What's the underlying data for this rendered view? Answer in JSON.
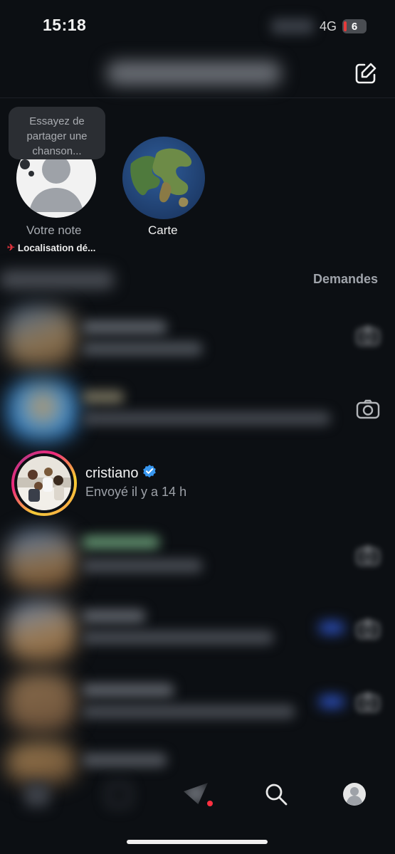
{
  "status_bar": {
    "time": "15:18",
    "network": "4G",
    "battery": "6"
  },
  "notes": {
    "bubble_text": "Essayez de partager une chanson...",
    "your_note_label": "Votre note",
    "location_label": "Localisation dé...",
    "map_label": "Carte"
  },
  "messages_section": {
    "requests_label": "Demandes"
  },
  "conversation": {
    "username": "cristiano",
    "subtitle": "Envoyé il y a 14 h",
    "verified": true
  },
  "colors": {
    "background": "#0c0f13",
    "verified_blue": "#3897f0",
    "notification_red": "#ff3040"
  },
  "icons": [
    "compose-icon",
    "camera-icon",
    "home-icon",
    "reels-icon",
    "send-icon",
    "search-icon",
    "profile-icon"
  ]
}
